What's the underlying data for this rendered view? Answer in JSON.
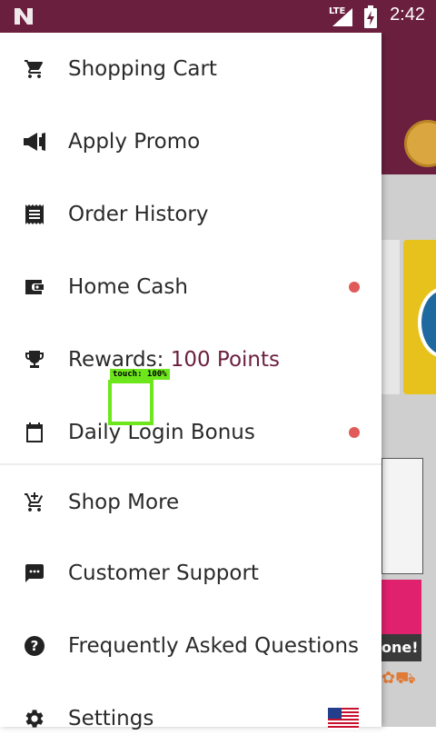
{
  "status_bar": {
    "network_type": "LTE",
    "time": "2:42"
  },
  "drawer": {
    "items": [
      {
        "label": "Shopping Cart",
        "icon": "cart-icon"
      },
      {
        "label": "Apply Promo",
        "icon": "megaphone-icon"
      },
      {
        "label": "Order History",
        "icon": "receipt-icon"
      },
      {
        "label": "Home Cash",
        "icon": "wallet-icon",
        "badge": true
      },
      {
        "label": "Rewards: ",
        "points": "100 Points",
        "icon": "trophy-icon"
      },
      {
        "label": "Daily Login Bonus",
        "icon": "calendar-icon",
        "badge": true
      },
      {
        "label": "Shop More",
        "icon": "add-cart-icon"
      },
      {
        "label": "Customer Support",
        "icon": "chat-icon"
      },
      {
        "label": "Frequently Asked Questions",
        "icon": "help-icon"
      },
      {
        "label": "Settings",
        "icon": "gear-icon",
        "flag": "us-flag-icon"
      }
    ]
  },
  "background_app": {
    "banner_text": "one!"
  },
  "touch_overlay": {
    "label": "touch: 100%"
  },
  "colors": {
    "brand": "#6b1f3f",
    "badge": "#e05a5a",
    "touch_highlight": "#6ee61c"
  }
}
